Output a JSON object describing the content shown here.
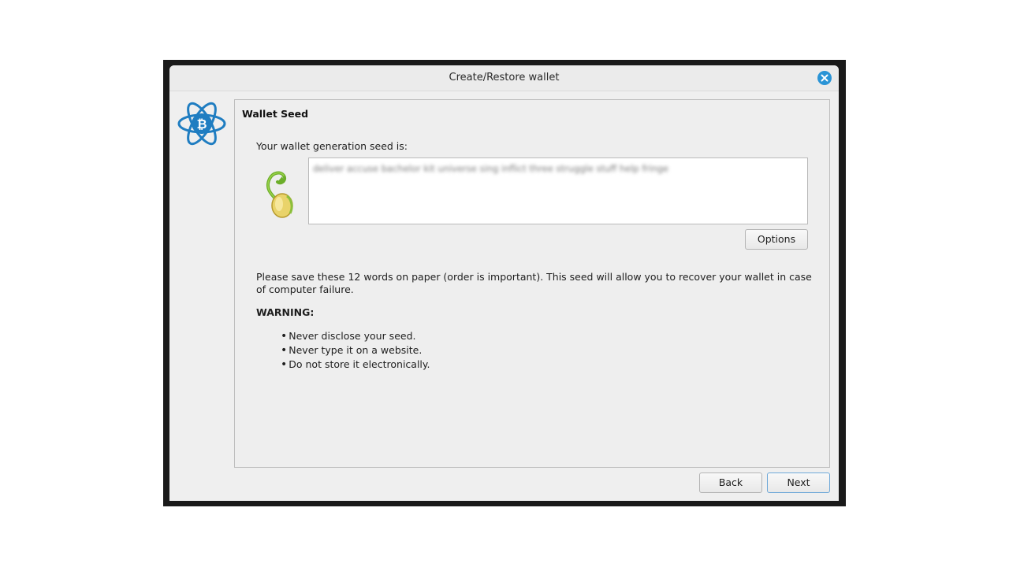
{
  "window": {
    "title": "Create/Restore wallet",
    "close_icon": "close-icon",
    "accent_color": "#2a94d6"
  },
  "sidebar": {
    "logo": "electrum-bitcoin-logo"
  },
  "panel": {
    "title": "Wallet Seed",
    "seed_label": "Your wallet generation seed is:",
    "seed_icon": "sprouting-seed-icon",
    "seed_text": "deliver accuse bachelor kit universe sing inflict three struggle stuff help fringe",
    "options_label": "Options",
    "info_text": "Please save these 12 words on paper (order is important). This seed will allow you to recover your wallet in case of computer failure.",
    "warning_label": "WARNING:",
    "warnings": [
      "Never disclose your seed.",
      "Never type it on a website.",
      "Do not store it electronically."
    ]
  },
  "footer": {
    "back_label": "Back",
    "next_label": "Next"
  }
}
